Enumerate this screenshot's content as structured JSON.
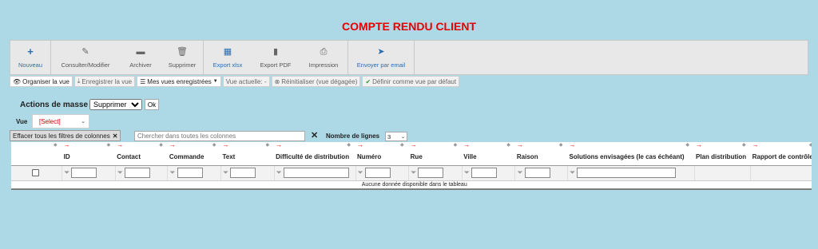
{
  "title": "COMPTE RENDU CLIENT",
  "toolbar": {
    "nouveau": "Nouveau",
    "consulter": "Consulter/Modifier",
    "archiver": "Archiver",
    "supprimer": "Supprimer",
    "export_xlsx": "Export xlsx",
    "export_pdf": "Export PDF",
    "impression": "Impression",
    "envoyer": "Envoyer par email"
  },
  "view_bar": {
    "organiser": "Organiser la vue",
    "enregistrer": "Enregistrer la vue",
    "mes_vues": "Mes vues enregistrées",
    "vue_actuelle": "Vue actuelle: -",
    "reinitialiser": "Réinitialiser (vue dégagée)",
    "defaut": "Définir comme vue par défaut"
  },
  "mass_actions": {
    "label": "Actions de masse",
    "selected": "Supprimer",
    "ok": "Ok"
  },
  "vue": {
    "label": "Vue",
    "selected": "[Select]"
  },
  "filters": {
    "clear_all": "Effacer tous les filtres de colonnes",
    "search_placeholder": "Chercher dans toutes les colonnes",
    "rows_label": "Nombre de lignes",
    "rows_value": "3"
  },
  "table": {
    "columns": [
      "ID",
      "Contact",
      "Commande",
      "Text",
      "Difficulté de distribution",
      "Numéro",
      "Rue",
      "Ville",
      "Raison",
      "Solutions envisagées (le cas échéant)",
      "Plan distribution",
      "Rapport de contrôle"
    ],
    "empty_message": "Aucune donnée disponible dans le tableau"
  },
  "colors": {
    "background": "#add8e6",
    "title": "#e60000",
    "accent_blue": "#2a6db0"
  }
}
